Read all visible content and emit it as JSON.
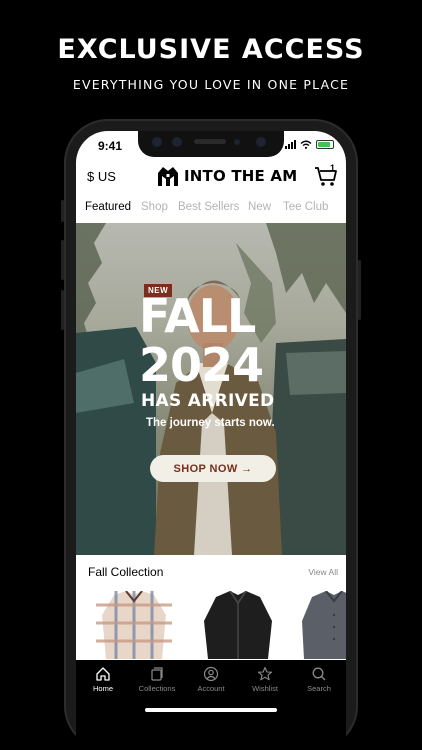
{
  "promo": {
    "title": "EXCLUSIVE ACCESS",
    "subtitle": "EVERYTHING YOU LOVE IN ONE PLACE"
  },
  "status_bar": {
    "time": "9:41"
  },
  "header": {
    "currency": "$ US",
    "brand": "INTO THE AM",
    "cart_count": "1"
  },
  "nav": {
    "tabs": [
      {
        "label": "Featured",
        "active": true
      },
      {
        "label": "Shop"
      },
      {
        "label": "Best Sellers"
      },
      {
        "label": "New"
      },
      {
        "label": "Tee Club"
      }
    ]
  },
  "hero": {
    "badge": "NEW",
    "title_line1": "FALL",
    "title_line2": "2024",
    "title_line3": "HAS ARRIVED",
    "tagline": "The journey starts now.",
    "cta": "SHOP NOW →"
  },
  "collection": {
    "title": "Fall Collection",
    "view_all": "View All"
  },
  "tab_bar": {
    "items": [
      {
        "label": "Home",
        "icon": "home-icon",
        "active": true
      },
      {
        "label": "Collections",
        "icon": "collections-icon"
      },
      {
        "label": "Account",
        "icon": "account-icon"
      },
      {
        "label": "Wishlist",
        "icon": "star-icon"
      },
      {
        "label": "Search",
        "icon": "search-icon"
      }
    ]
  },
  "colors": {
    "background": "#000000",
    "accent": "#7a2e1b",
    "cta_background": "#f2efe6"
  }
}
